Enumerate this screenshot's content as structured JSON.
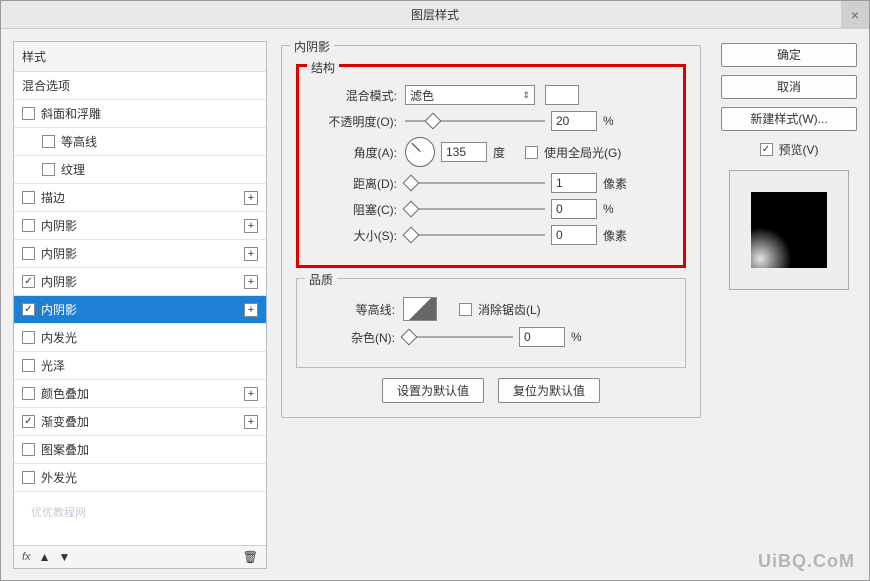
{
  "title": "图层样式",
  "left": {
    "header": "样式",
    "blendOptions": "混合选项",
    "items": [
      {
        "label": "斜面和浮雕",
        "checked": false,
        "plus": false,
        "indent": 0
      },
      {
        "label": "等高线",
        "checked": false,
        "plus": false,
        "indent": 1
      },
      {
        "label": "纹理",
        "checked": false,
        "plus": false,
        "indent": 1
      },
      {
        "label": "描边",
        "checked": false,
        "plus": true,
        "indent": 0
      },
      {
        "label": "内阴影",
        "checked": false,
        "plus": true,
        "indent": 0
      },
      {
        "label": "内阴影",
        "checked": false,
        "plus": true,
        "indent": 0
      },
      {
        "label": "内阴影",
        "checked": true,
        "plus": true,
        "indent": 0
      },
      {
        "label": "内阴影",
        "checked": true,
        "plus": true,
        "indent": 0,
        "selected": true
      },
      {
        "label": "内发光",
        "checked": false,
        "plus": false,
        "indent": 0
      },
      {
        "label": "光泽",
        "checked": false,
        "plus": false,
        "indent": 0
      },
      {
        "label": "颜色叠加",
        "checked": false,
        "plus": true,
        "indent": 0
      },
      {
        "label": "渐变叠加",
        "checked": true,
        "plus": true,
        "indent": 0
      },
      {
        "label": "图案叠加",
        "checked": false,
        "plus": false,
        "indent": 0
      },
      {
        "label": "外发光",
        "checked": false,
        "plus": false,
        "indent": 0
      }
    ],
    "footer": {
      "fx": "fx",
      "up": "▲",
      "down": "▼",
      "trash": "🗑"
    }
  },
  "center": {
    "sectionTitle": "内阴影",
    "structure": {
      "legend": "结构",
      "blendModeLabel": "混合模式:",
      "blendModeValue": "滤色",
      "opacityLabel": "不透明度(O):",
      "opacityValue": "20",
      "opacityUnit": "%",
      "angleLabel": "角度(A):",
      "angleValue": "135",
      "angleUnit": "度",
      "globalLabel": "使用全局光(G)",
      "distanceLabel": "距离(D):",
      "distanceValue": "1",
      "distanceUnit": "像素",
      "chokeLabel": "阻塞(C):",
      "chokeValue": "0",
      "chokeUnit": "%",
      "sizeLabel": "大小(S):",
      "sizeValue": "0",
      "sizeUnit": "像素"
    },
    "quality": {
      "legend": "品质",
      "contourLabel": "等高线:",
      "antiAliasLabel": "消除锯齿(L)",
      "noiseLabel": "杂色(N):",
      "noiseValue": "0",
      "noiseUnit": "%"
    },
    "setDefault": "设置为默认值",
    "resetDefault": "复位为默认值"
  },
  "right": {
    "ok": "确定",
    "cancel": "取消",
    "newStyle": "新建样式(W)...",
    "preview": "预览(V)"
  },
  "watermark": "UiBQ.CoM",
  "watermark2": "优优教程网"
}
